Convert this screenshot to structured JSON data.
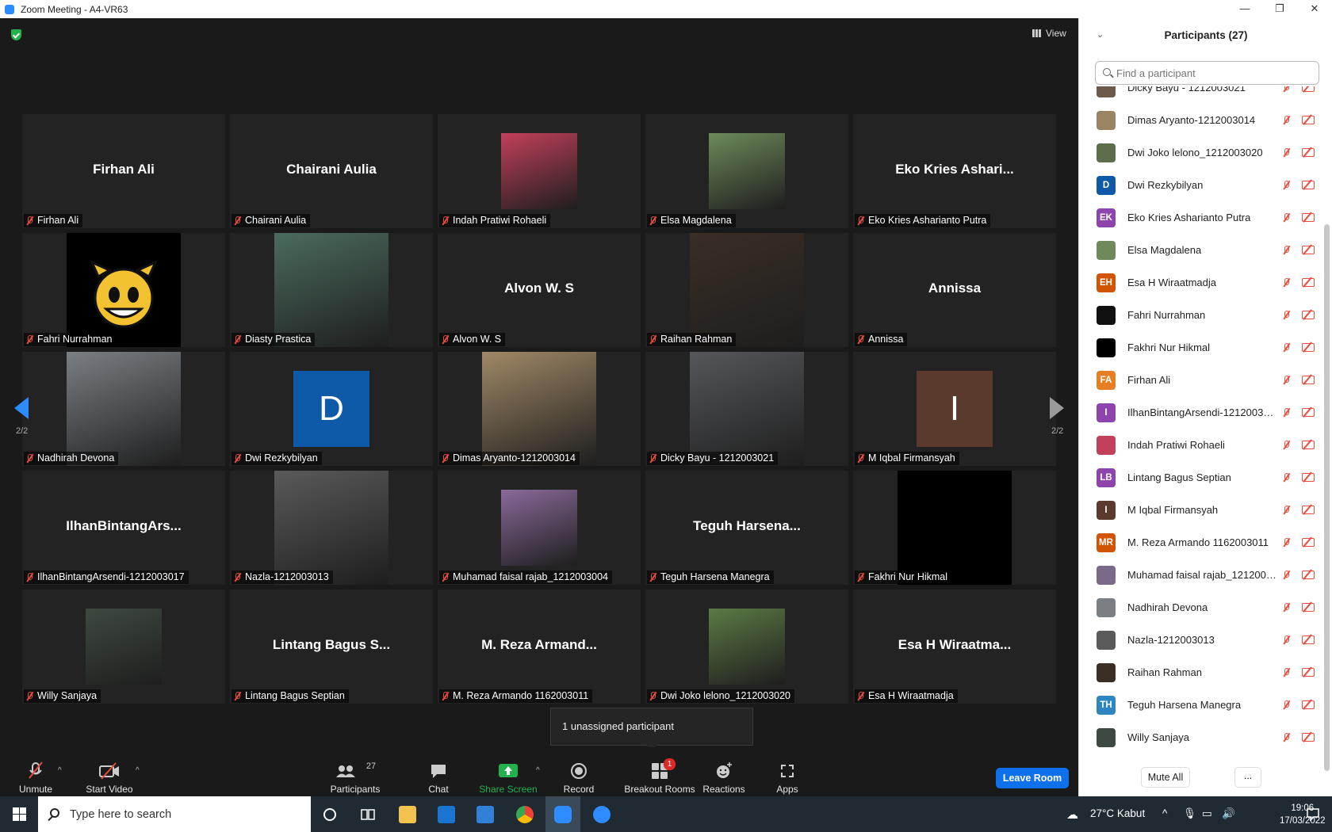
{
  "window": {
    "title": "Zoom Meeting - A4-VR63",
    "minimize": "—",
    "restore": "❐",
    "close": "✕"
  },
  "meeting": {
    "view_label": "View",
    "page_left": "2/2",
    "page_right": "2/2",
    "tiles": [
      {
        "big": "Firhan Ali",
        "name": "Firhan Ali",
        "kind": "name"
      },
      {
        "big": "Chairani Aulia",
        "name": "Chairani Aulia",
        "kind": "name"
      },
      {
        "big": "",
        "name": "Indah Pratiwi Rohaeli",
        "kind": "photo",
        "color": "#c2405a"
      },
      {
        "big": "",
        "name": "Elsa Magdalena",
        "kind": "photo",
        "color": "#6e8a5a"
      },
      {
        "big": "Eko Kries Ashari...",
        "name": "Eko Kries Asharianto Putra",
        "kind": "name"
      },
      {
        "big": "",
        "name": "Fahri Nurrahman",
        "kind": "bendy"
      },
      {
        "big": "",
        "name": "Diasty Prastica",
        "kind": "photo",
        "color": "#4b6b5e"
      },
      {
        "big": "Alvon W. S",
        "name": "Alvon W. S",
        "kind": "name"
      },
      {
        "big": "",
        "name": "Raihan Rahman",
        "kind": "photo",
        "color": "#3a2e25"
      },
      {
        "big": "Annissa",
        "name": "Annissa",
        "kind": "name"
      },
      {
        "big": "",
        "name": "Nadhirah Devona",
        "kind": "photo",
        "color": "#7a7f84"
      },
      {
        "big": "",
        "name": "Dwi Rezkybilyan",
        "kind": "initial",
        "letter": "D",
        "color": "#0f5aa8"
      },
      {
        "big": "",
        "name": "Dimas Aryanto-1212003014",
        "kind": "photo",
        "color": "#a08866"
      },
      {
        "big": "",
        "name": "Dicky Bayu - 1212003021",
        "kind": "photo",
        "color": "#55575a"
      },
      {
        "big": "",
        "name": "M Iqbal Firmansyah",
        "kind": "initial",
        "letter": "I",
        "color": "#5b3a2e"
      },
      {
        "big": "IlhanBintangArs...",
        "name": "IlhanBintangArsendi-1212003017",
        "kind": "name"
      },
      {
        "big": "",
        "name": "Nazla-1212003013",
        "kind": "photo",
        "color": "#5a5a5a"
      },
      {
        "big": "",
        "name": "Muhamad faisal rajab_1212003004",
        "kind": "photo",
        "color": "#8a6a9a"
      },
      {
        "big": "Teguh Harsena...",
        "name": "Teguh Harsena Manegra",
        "kind": "name"
      },
      {
        "big": "",
        "name": "Fakhri Nur Hikmal",
        "kind": "black"
      },
      {
        "big": "",
        "name": "Willy Sanjaya",
        "kind": "photo",
        "color": "#3e4a40"
      },
      {
        "big": "Lintang Bagus S...",
        "name": "Lintang Bagus Septian",
        "kind": "name"
      },
      {
        "big": "M. Reza Armand...",
        "name": "M. Reza Armando 1162003011",
        "kind": "name"
      },
      {
        "big": "",
        "name": "Dwi Joko lelono_1212003020",
        "kind": "photo",
        "color": "#5c7a44"
      },
      {
        "big": "Esa H Wiraatma...",
        "name": "Esa H Wiraatmadja",
        "kind": "name"
      }
    ],
    "tooltip": "1 unassigned participant"
  },
  "toolbar": {
    "unmute": "Unmute",
    "start_video": "Start Video",
    "participants": "Participants",
    "participants_count": "27",
    "chat": "Chat",
    "share_screen": "Share Screen",
    "record": "Record",
    "breakout_rooms": "Breakout Rooms",
    "breakout_badge": "1",
    "reactions": "Reactions",
    "apps": "Apps",
    "leave_room": "Leave Room"
  },
  "panel": {
    "title": "Participants (27)",
    "search_placeholder": "Find a participant",
    "mute_all": "Mute All",
    "more": "...",
    "participants": [
      {
        "name": "Dicky Bayu - 1212003021",
        "initials": "",
        "color": "#6d5a4a"
      },
      {
        "name": "Dimas Aryanto-1212003014",
        "initials": "",
        "color": "#9a8462"
      },
      {
        "name": "Dwi Joko lelono_1212003020",
        "initials": "",
        "color": "#5c6f4a"
      },
      {
        "name": "Dwi Rezkybilyan",
        "initials": "D",
        "color": "#0f5aa8"
      },
      {
        "name": "Eko Kries Asharianto Putra",
        "initials": "EK",
        "color": "#8e44ad"
      },
      {
        "name": "Elsa Magdalena",
        "initials": "",
        "color": "#6e8a5a"
      },
      {
        "name": "Esa H Wiraatmadja",
        "initials": "EH",
        "color": "#d35400"
      },
      {
        "name": "Fahri Nurrahman",
        "initials": "",
        "color": "#111111"
      },
      {
        "name": "Fakhri Nur Hikmal",
        "initials": "",
        "color": "#000000"
      },
      {
        "name": "Firhan Ali",
        "initials": "FA",
        "color": "#e67e22"
      },
      {
        "name": "IlhanBintangArsendi-1212003017",
        "initials": "I",
        "color": "#8e44ad"
      },
      {
        "name": "Indah Pratiwi Rohaeli",
        "initials": "",
        "color": "#c2405a"
      },
      {
        "name": "Lintang Bagus Septian",
        "initials": "LB",
        "color": "#8e44ad"
      },
      {
        "name": "M Iqbal Firmansyah",
        "initials": "I",
        "color": "#5b3a2e"
      },
      {
        "name": "M. Reza Armando 1162003011",
        "initials": "MR",
        "color": "#d35400"
      },
      {
        "name": "Muhamad faisal rajab_1212003...",
        "initials": "",
        "color": "#7a6a8a"
      },
      {
        "name": "Nadhirah Devona",
        "initials": "",
        "color": "#7a7f84"
      },
      {
        "name": "Nazla-1212003013",
        "initials": "",
        "color": "#5a5a5a"
      },
      {
        "name": "Raihan Rahman",
        "initials": "",
        "color": "#3a2e25"
      },
      {
        "name": "Teguh Harsena Manegra",
        "initials": "TH",
        "color": "#2e86c1"
      },
      {
        "name": "Willy Sanjaya",
        "initials": "",
        "color": "#3e4a40"
      }
    ]
  },
  "taskbar": {
    "search_placeholder": "Type here to search",
    "weather": "27°C  Kabut",
    "time": "19:06",
    "date": "17/03/2022"
  }
}
